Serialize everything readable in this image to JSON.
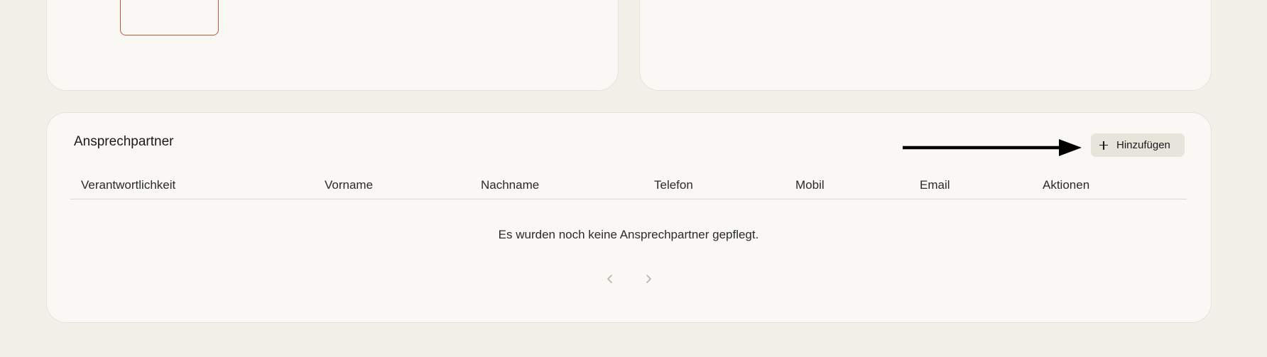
{
  "contacts": {
    "title": "Ansprechpartner",
    "add_label": "Hinzufügen",
    "columns": [
      "Verantwortlichkeit",
      "Vorname",
      "Nachname",
      "Telefon",
      "Mobil",
      "Email",
      "Aktionen"
    ],
    "empty_message": "Es wurden noch keine Ansprechpartner gepflegt."
  },
  "icons": {
    "add_tile": "plus-icon",
    "add_button": "plus-icon",
    "arrow": "arrow-right-icon",
    "prev": "chevron-left-icon",
    "next": "chevron-right-icon"
  },
  "colors": {
    "page_bg": "#f3f0ea",
    "card_bg": "#faf8f4",
    "accent": "#c9553f",
    "button_bg": "#e7e4dc"
  }
}
